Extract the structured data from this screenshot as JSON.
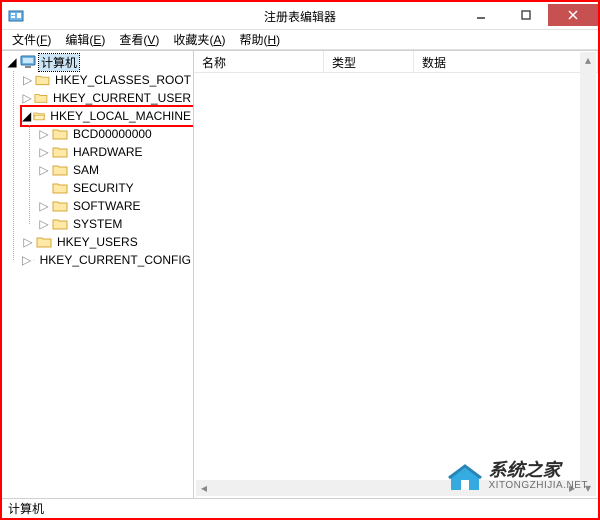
{
  "window": {
    "title": "注册表编辑器"
  },
  "menu": {
    "file": {
      "label": "文件",
      "hotkey": "F"
    },
    "edit": {
      "label": "编辑",
      "hotkey": "E"
    },
    "view": {
      "label": "查看",
      "hotkey": "V"
    },
    "favorites": {
      "label": "收藏夹",
      "hotkey": "A"
    },
    "help": {
      "label": "帮助",
      "hotkey": "H"
    }
  },
  "columns": {
    "name": "名称",
    "type": "类型",
    "data": "数据"
  },
  "tree": {
    "root": "计算机",
    "hkcr": "HKEY_CLASSES_ROOT",
    "hkcu": "HKEY_CURRENT_USER",
    "hklm": "HKEY_LOCAL_MACHINE",
    "hklm_children": {
      "bcd": "BCD00000000",
      "hardware": "HARDWARE",
      "sam": "SAM",
      "security": "SECURITY",
      "software": "SOFTWARE",
      "system": "SYSTEM"
    },
    "hku": "HKEY_USERS",
    "hkcc": "HKEY_CURRENT_CONFIG"
  },
  "statusbar": {
    "path": "计算机"
  },
  "watermark": {
    "cn": "系统之家",
    "en": "XITONGZHIJIA.NET"
  }
}
